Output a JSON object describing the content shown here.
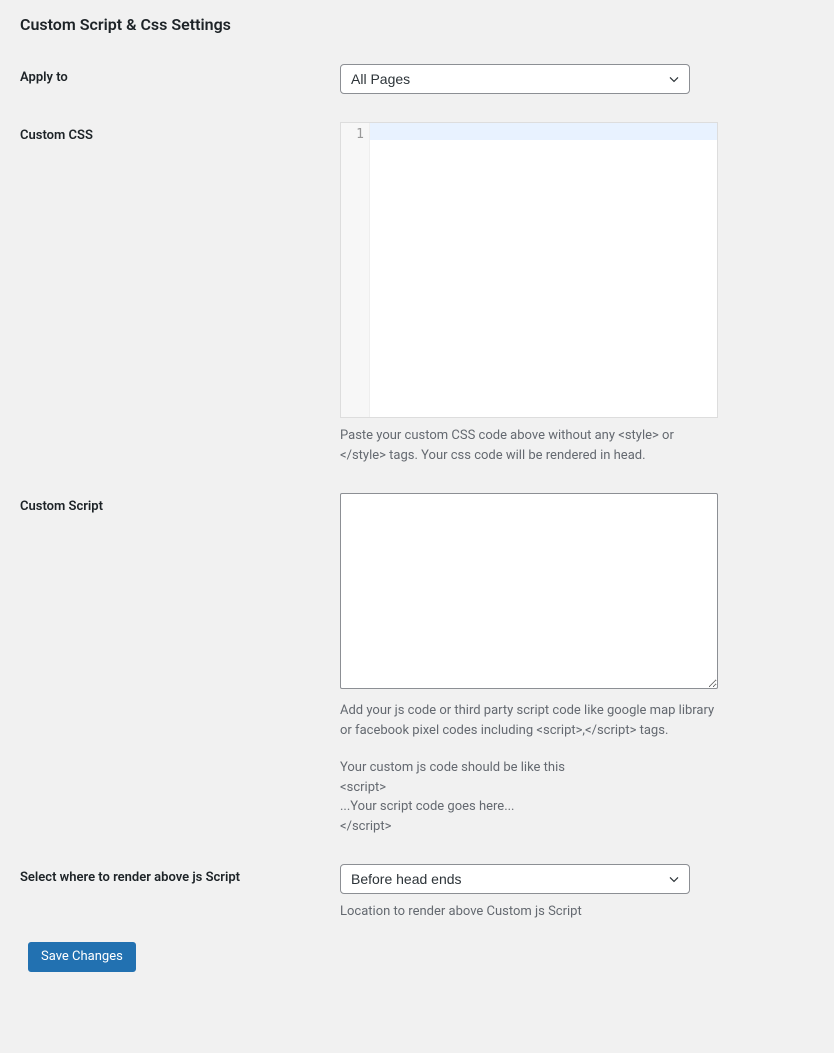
{
  "heading": "Custom Script & Css Settings",
  "fields": {
    "applyTo": {
      "label": "Apply to",
      "value": "All Pages"
    },
    "customCss": {
      "label": "Custom CSS",
      "lineNumber": "1",
      "value": "",
      "help": "Paste your custom CSS code above without any <style> or </style> tags. Your css code will be rendered in head."
    },
    "customScript": {
      "label": "Custom Script",
      "value": "",
      "help1": "Add your js code or third party script code like google map library or facebook pixel codes including <script>,</script> tags.",
      "help2a": "Your custom js code should be like this",
      "help2b": "<script>",
      "help2c": "...Your script code goes here...",
      "help2d": "</script>"
    },
    "renderLocation": {
      "label": "Select where to render above js Script",
      "value": "Before head ends",
      "help": "Location to render above Custom js Script"
    }
  },
  "submit": {
    "label": "Save Changes"
  }
}
